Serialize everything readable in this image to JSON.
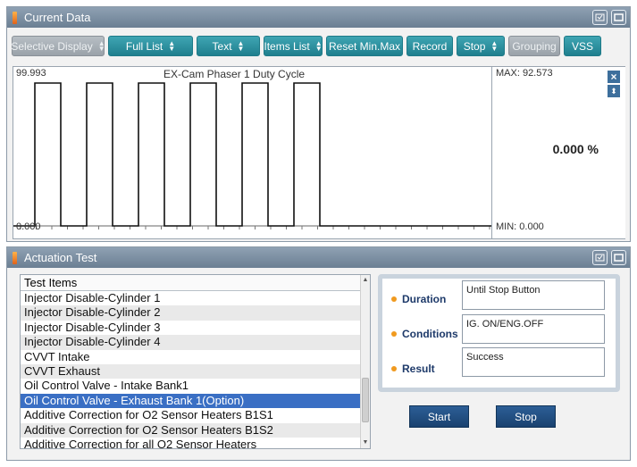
{
  "current": {
    "title": "Current Data",
    "toolbar": {
      "selective": "Selective Display",
      "full_list": "Full List",
      "text": "Text",
      "items_list": "Items List",
      "reset": "Reset Min.Max",
      "record": "Record",
      "stop": "Stop",
      "grouping": "Grouping",
      "vss": "VSS"
    },
    "graph": {
      "title": "EX-Cam Phaser 1 Duty Cycle",
      "y_max": "99.993",
      "y_min": "0.000",
      "max": "MAX: 92.573",
      "min": "MIN: 0.000",
      "value": "0.000 %",
      "signal": [
        0,
        1,
        0,
        1,
        0,
        1,
        0,
        1,
        0,
        1,
        0,
        1,
        0
      ]
    }
  },
  "actuation": {
    "title": "Actuation Test",
    "list_header": "Test Items",
    "items": [
      "Injector Disable-Cylinder 1",
      "Injector Disable-Cylinder 2",
      "Injector Disable-Cylinder 3",
      "Injector Disable-Cylinder 4",
      "CVVT Intake",
      "CVVT Exhaust",
      "Oil Control Valve - Intake Bank1",
      "Oil Control Valve - Exhaust Bank 1(Option)",
      "Additive Correction for O2 Sensor Heaters B1S1",
      "Additive Correction for O2 Sensor Heaters B1S2",
      "Additive Correction for all O2 Sensor Heaters"
    ],
    "selected_index": 7,
    "labels": {
      "duration": "Duration",
      "conditions": "Conditions",
      "result": "Result"
    },
    "values": {
      "duration": "Until Stop Button",
      "conditions": "IG. ON/ENG.OFF",
      "result": "Success"
    },
    "start": "Start",
    "stop": "Stop"
  },
  "colors": {
    "accent": "#2f8d9b",
    "selection": "#3a6fc4",
    "titlebar": "#7b8ea2"
  }
}
